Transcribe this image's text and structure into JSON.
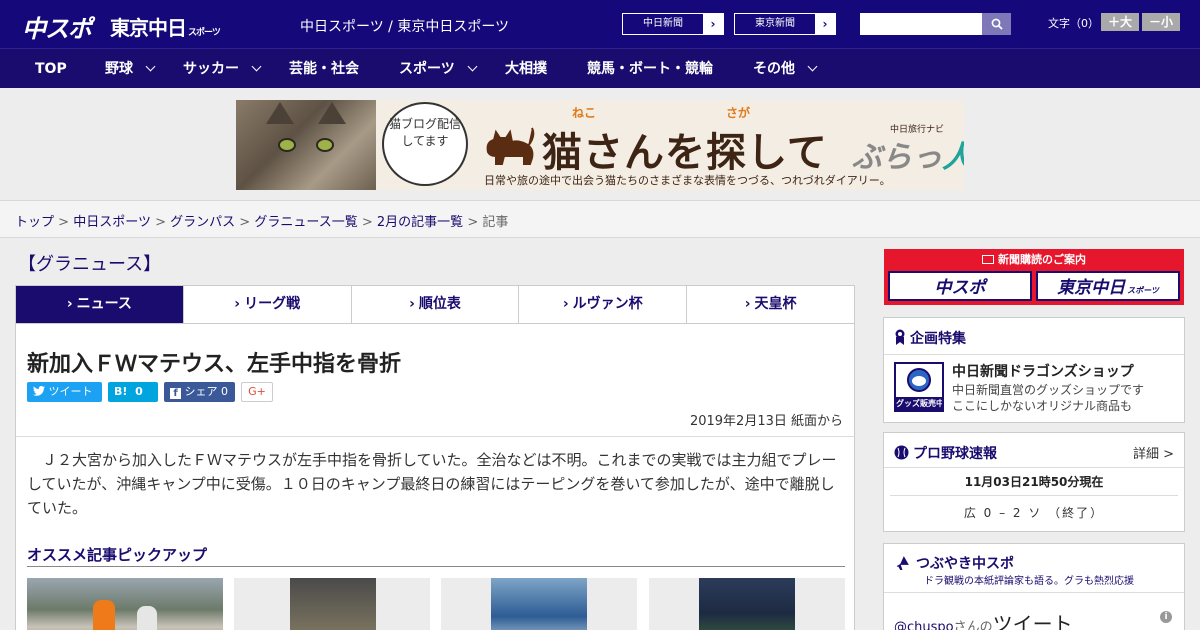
{
  "header": {
    "logo_chuspo": "中スポ",
    "logo_tokyo": "東京中日",
    "logo_tokyo_small": "スポーツ",
    "site_title": "中日スポーツ / 東京中日スポーツ",
    "link_chunichi": "中日新聞",
    "link_tokyo": "東京新聞",
    "search_value": "",
    "font_size_label": "文字（0）",
    "font_larger": "＋大",
    "font_smaller": "－小"
  },
  "nav": {
    "items": [
      {
        "label": "TOP",
        "has_menu": false
      },
      {
        "label": "野球",
        "has_menu": true
      },
      {
        "label": "サッカー",
        "has_menu": true
      },
      {
        "label": "芸能・社会",
        "has_menu": false
      },
      {
        "label": "スポーツ",
        "has_menu": true
      },
      {
        "label": "大相撲",
        "has_menu": false
      },
      {
        "label": "競馬・ボート・競輪",
        "has_menu": false
      },
      {
        "label": "その他",
        "has_menu": true
      }
    ]
  },
  "banner": {
    "bubble_text": "猫ブログ配信してます",
    "ruby_neko": "ねこ",
    "ruby_saga": "さが",
    "title": "猫さんを探して",
    "subtitle": "日常や旅の途中で出会う猫たちのさまざまな表情をつづる、つれづれダイアリー。",
    "travel_navi": "中日旅行ナビ",
    "brand_a": "ぶらっ",
    "brand_b": "人"
  },
  "breadcrumb": {
    "items": [
      "トップ",
      "中日スポーツ",
      "グランパス",
      "グラニュース一覧",
      "2月の記事一覧"
    ],
    "current": "記事",
    "separator": ">"
  },
  "section": {
    "heading": "【グラニュース】",
    "tabs": [
      {
        "label": "ニュース",
        "active": true
      },
      {
        "label": "リーグ戦",
        "active": false
      },
      {
        "label": "順位表",
        "active": false
      },
      {
        "label": "ルヴァン杯",
        "active": false
      },
      {
        "label": "天皇杯",
        "active": false
      }
    ]
  },
  "article": {
    "title": "新加入ＦＷマテウス、左手中指を骨折",
    "share_tweet": "ツイート",
    "share_hatena": "B!",
    "share_hatena_count": "0",
    "share_facebook": "シェア",
    "share_facebook_count": "0",
    "share_gplus": "G+",
    "date": "2019年2月13日 紙面から",
    "body": "　Ｊ２大宮から加入したＦＷマテウスが左手中指を骨折していた。全治などは不明。これまでの実戦では主力組でプレーしていたが、沖縄キャンプ中に受傷。１０日のキャンプ最終日の練習にはテーピングを巻いて参加したが、途中で離脱していた。",
    "pickup_heading": "オススメ記事ピックアップ"
  },
  "sidebar": {
    "subscription_title": "新聞購読のご案内",
    "subscription_logo_1": "中スポ",
    "subscription_logo_2": "東京中日",
    "subscription_logo_2_small": "スポーツ",
    "special_title": "企画特集",
    "special_item_title": "中日新聞ドラゴンズショップ",
    "special_item_desc_1": "中日新聞直営のグッズショップです",
    "special_item_desc_2": "ここにしかないオリジナル商品も",
    "special_thumb_text": "グッズ販売中",
    "baseball_title": "プロ野球速報",
    "baseball_detail": "詳細 >",
    "baseball_time": "11月03日21時50分現在",
    "baseball_score": "広 0 – 2 ソ （終了）",
    "twitter_title": "つぶやき中スポ",
    "twitter_sub": "ドラ観戦の本紙評論家も語る。グラも熱烈応援",
    "twitter_handle": "@chuspo",
    "twitter_handle_suffix": "さんの",
    "twitter_tweet_label": "ツイート"
  },
  "colors": {
    "brand_navy": "#14087a",
    "nav_bg": "#1a0c6e",
    "accent_red": "#e6162d",
    "twitter": "#1da1f2",
    "hatena": "#00a4de",
    "facebook": "#3b5998"
  }
}
